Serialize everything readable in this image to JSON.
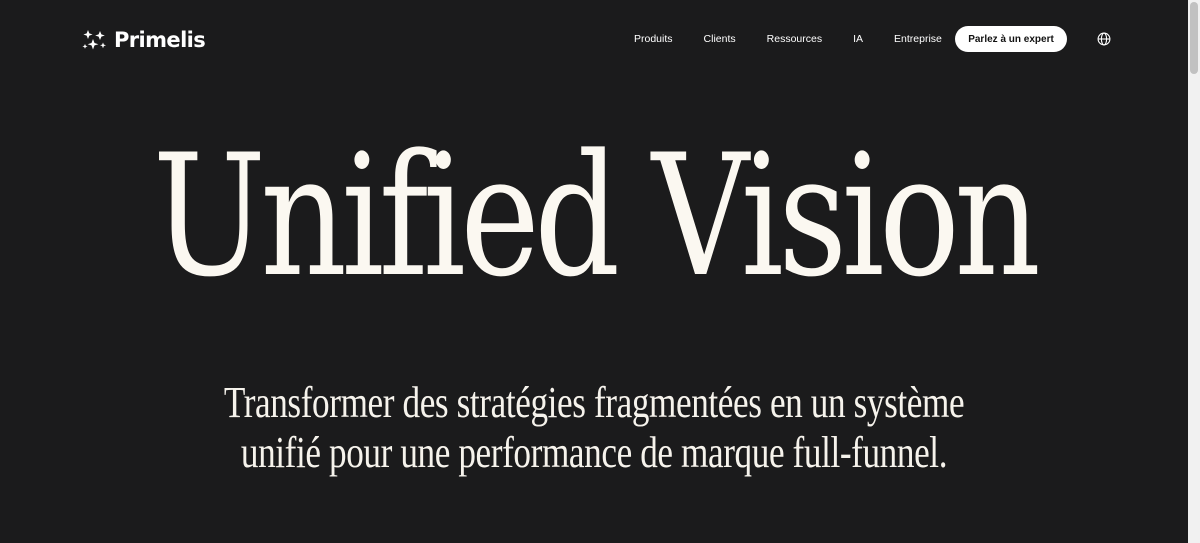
{
  "brand": {
    "name": "Primelis",
    "logo_icon": "primelis-star-cluster-icon"
  },
  "nav": {
    "items": [
      {
        "label": "Produits"
      },
      {
        "label": "Clients"
      },
      {
        "label": "Ressources"
      },
      {
        "label": "IA"
      },
      {
        "label": "Entreprise"
      }
    ],
    "cta_label": "Parlez à un expert",
    "language_icon": "globe-icon"
  },
  "hero": {
    "title": "Unified Vision",
    "subtitle_lines": [
      "Transformer des stratégies fragmentées en un système",
      "unifié pour une performance de marque full-funnel."
    ]
  },
  "colors": {
    "background": "#1b1b1c",
    "text": "#f6f3ec",
    "cta_background": "#ffffff",
    "cta_text": "#111111"
  }
}
